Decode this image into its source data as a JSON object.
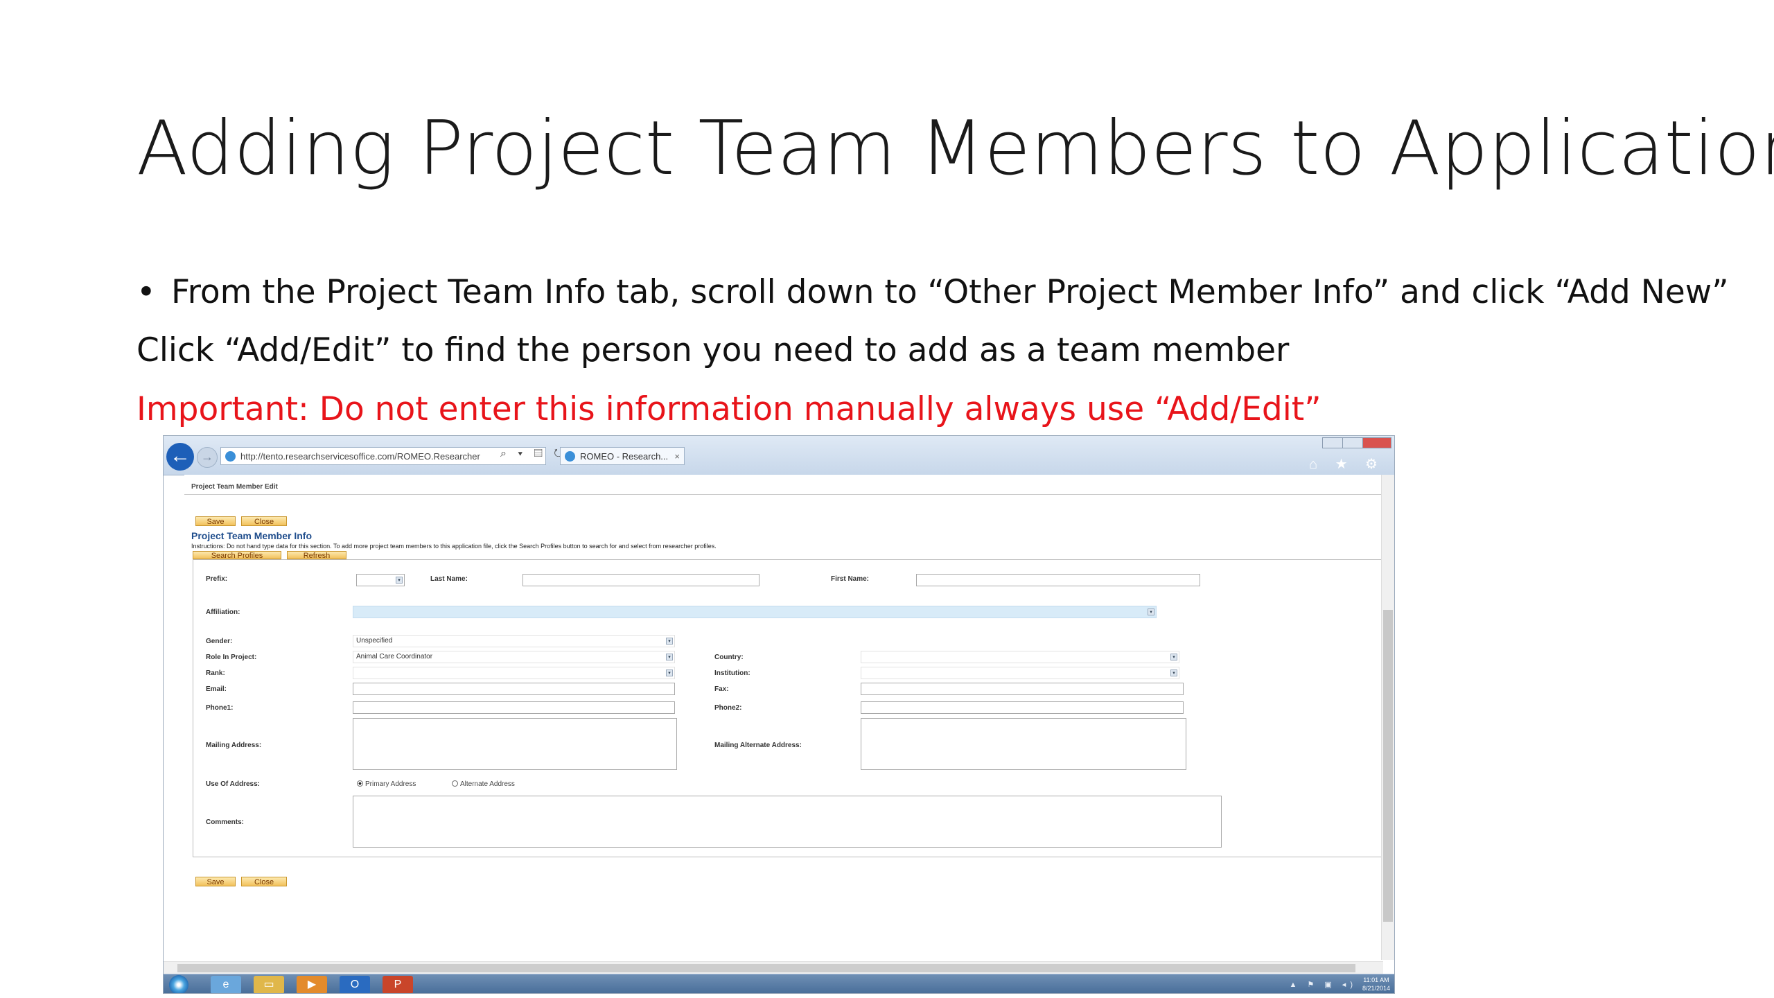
{
  "slide": {
    "title": "Adding Project Team Members to Application",
    "bullet_symbol": "•",
    "bullet": "From the Project Team Info tab, scroll down to “Other Project Member Info” and click “Add New”",
    "line2": "Click “Add/Edit” to find the person you need to add as a team member",
    "important": "Important: Do not enter this information manually always use “Add/Edit”",
    "important_color": "#e8141a"
  },
  "browser": {
    "address": "http://tento.researchservicesoffice.com/ROMEO.Researcher",
    "tab_title": "ROMEO - Research...",
    "tab_close": "×",
    "back_glyph": "←",
    "forward_glyph": "→",
    "address_icons": "⌕ ▾ ▤ ↻",
    "toolbar_icons": "⌂ ★ ⚙"
  },
  "page": {
    "header": "Project Team Member Edit",
    "save_label": "Save",
    "close_label": "Close",
    "section_title": "Project Team Member Info",
    "instructions": "Instructions: Do not hand type data for this section. To add more project team members to this application file, click the Search Profiles button to search for and select from researcher profiles.",
    "search_profiles_label": "Search Profiles",
    "refresh_label": "Refresh",
    "form": {
      "prefix_label": "Prefix:",
      "prefix_value": "",
      "last_name_label": "Last Name:",
      "last_name_value": "",
      "first_name_label": "First Name:",
      "first_name_value": "",
      "affiliation_label": "Affiliation:",
      "affiliation_value": "",
      "gender_label": "Gender:",
      "gender_value": "Unspecified",
      "role_label": "Role In Project:",
      "role_value": "Animal Care Coordinator",
      "rank_label": "Rank:",
      "rank_value": "",
      "email_label": "Email:",
      "phone1_label": "Phone1:",
      "mailing_address_label": "Mailing Address:",
      "country_label": "Country:",
      "institution_label": "Institution:",
      "fax_label": "Fax:",
      "phone2_label": "Phone2:",
      "mailing_alt_label": "Mailing Alternate Address:",
      "use_of_address_label": "Use Of Address:",
      "primary_address_label": "Primary Address",
      "alternate_address_label": "Alternate Address",
      "primary_selected": true,
      "comments_label": "Comments:",
      "dropdown_glyph": "▾"
    }
  },
  "taskbar": {
    "apps": [
      "ie-icon",
      "folder-icon",
      "media-player-icon",
      "outlook-icon",
      "powerpoint-icon"
    ],
    "tray_icons": "▲ ⚑ ▣ ◂)",
    "time": "11:01 AM",
    "date": "8/21/2014"
  }
}
